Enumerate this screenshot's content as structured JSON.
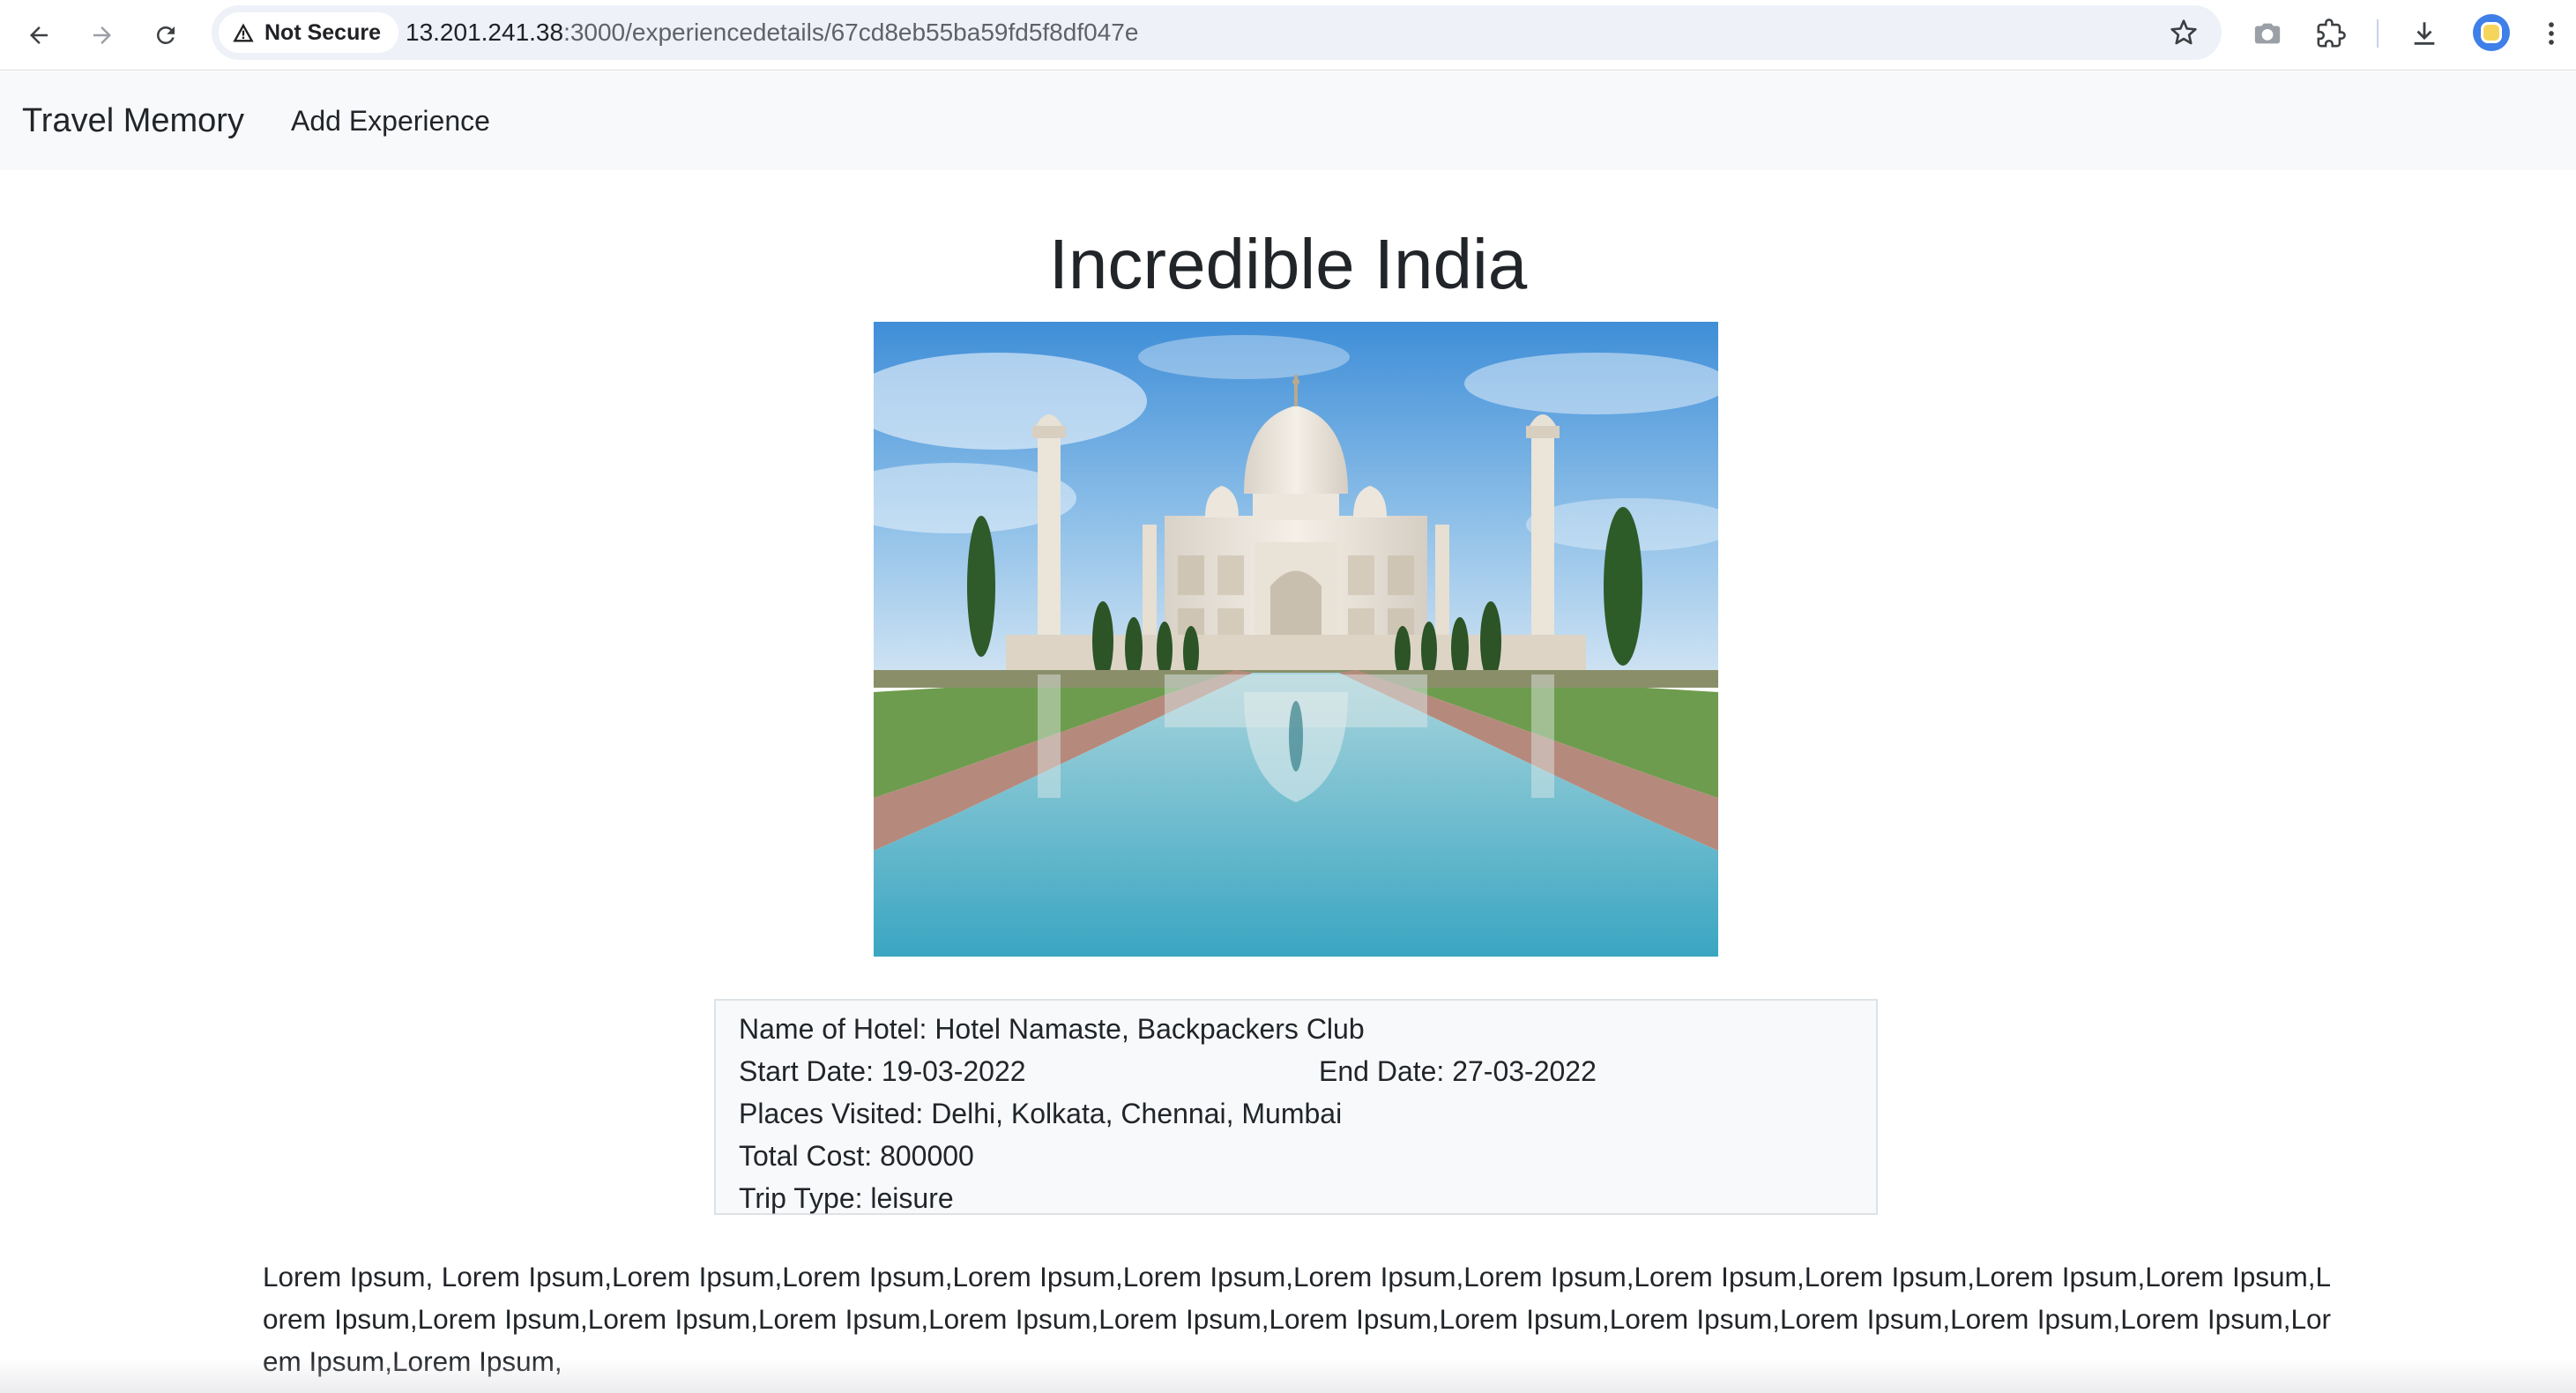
{
  "browser": {
    "security_label": "Not Secure",
    "url_host": "13.201.241.38",
    "url_path": ":3000/experiencedetails/67cd8eb55ba59fd5f8df047e",
    "icons": {
      "back": "arrow-left-icon",
      "forward": "arrow-right-icon",
      "reload": "reload-icon",
      "security": "warning-triangle-icon",
      "bookmark": "star-icon",
      "screenshot": "camera-icon",
      "extensions": "puzzle-icon",
      "downloads": "download-icon",
      "profile": "avatar-icon",
      "menu": "kebab-menu-icon"
    }
  },
  "navbar": {
    "brand": "Travel Memory",
    "links": [
      {
        "label": "Add Experience"
      }
    ]
  },
  "experience": {
    "title": "Incredible India",
    "image_alt": "Taj Mahal with reflecting pool",
    "hotel_label": "Name of Hotel:",
    "hotel": "Hotel Namaste, Backpackers Club",
    "start_label": "Start Date:",
    "start_date": "19-03-2022",
    "end_label": "End Date:",
    "end_date": "27-03-2022",
    "places_label": "Places Visited:",
    "places": "Delhi, Kolkata, Chennai, Mumbai",
    "cost_label": "Total Cost:",
    "cost": "800000",
    "trip_type_label": "Trip Type:",
    "trip_type": "leisure",
    "description": "Lorem Ipsum, Lorem Ipsum,Lorem Ipsum,Lorem Ipsum,Lorem Ipsum,Lorem Ipsum,Lorem Ipsum,Lorem Ipsum,Lorem Ipsum,Lorem Ipsum,Lorem Ipsum,Lorem Ipsum,Lorem Ipsum,Lorem Ipsum,Lorem Ipsum,Lorem Ipsum,Lorem Ipsum,Lorem Ipsum,Lorem Ipsum,Lorem Ipsum,Lorem Ipsum,Lorem Ipsum,Lorem Ipsum,Lorem Ipsum,Lorem Ipsum,Lorem Ipsum,"
  },
  "colors": {
    "navbar_bg": "#f8f9fa",
    "card_bg": "#f8f9fa",
    "card_border": "#dee2e6",
    "text": "#212529",
    "omnibox_bg": "#eef1f8"
  }
}
